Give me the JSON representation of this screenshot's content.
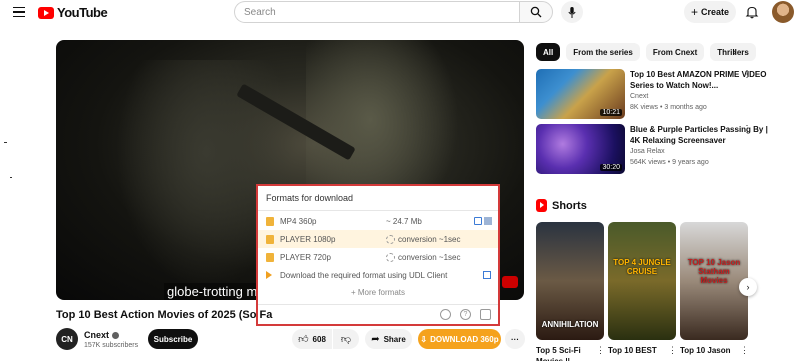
{
  "header": {
    "logo_text": "YouTube",
    "search_placeholder": "Search",
    "create_label": "Create"
  },
  "player": {
    "subtitle": "globe-trotting mis"
  },
  "download_popup": {
    "title": "Formats for download",
    "formats": [
      {
        "name": "MP4 360p",
        "size": "~ 24.7 Mb"
      },
      {
        "name": "PLAYER 1080p",
        "status": "conversion ~1sec"
      },
      {
        "name": "PLAYER 720p",
        "status": "conversion ~1sec"
      }
    ],
    "udl_text": "Download the required format using UDL Client",
    "more_formats": "+ More formats"
  },
  "video": {
    "title": "Top 10 Best Action Movies of 2025 (So Fa",
    "channel": {
      "avatar_text": "CN",
      "name": "Cnext",
      "subscribers": "157K subscribers"
    },
    "subscribe_label": "Subscribe",
    "like_count": "608",
    "share_label": "Share",
    "download_label": "DOWNLOAD 360p"
  },
  "chips": [
    "All",
    "From the series",
    "From Cnext",
    "Thrillers"
  ],
  "recommendations": [
    {
      "title": "Top 10 Best AMAZON PRIME VIDEO Series to Watch Now!...",
      "channel": "Cnext",
      "meta": "8K views • 3 months ago",
      "duration": "10:21"
    },
    {
      "title": "Blue & Purple Particles Passing By | 4K Relaxing Screensaver",
      "channel": "Josa Relax",
      "meta": "564K views • 9 years ago",
      "duration": "30:20"
    }
  ],
  "shorts": {
    "heading": "Shorts",
    "items": [
      {
        "title": "Top 5 Sci-Fi Movies ||",
        "caption": "ANNIHILATION"
      },
      {
        "title": "Top 10 BEST",
        "caption": "TOP 4 JUNGLE CRUISE"
      },
      {
        "title": "Top 10 Jason",
        "caption": "TOP 10 Jason Statham Movies"
      }
    ]
  }
}
